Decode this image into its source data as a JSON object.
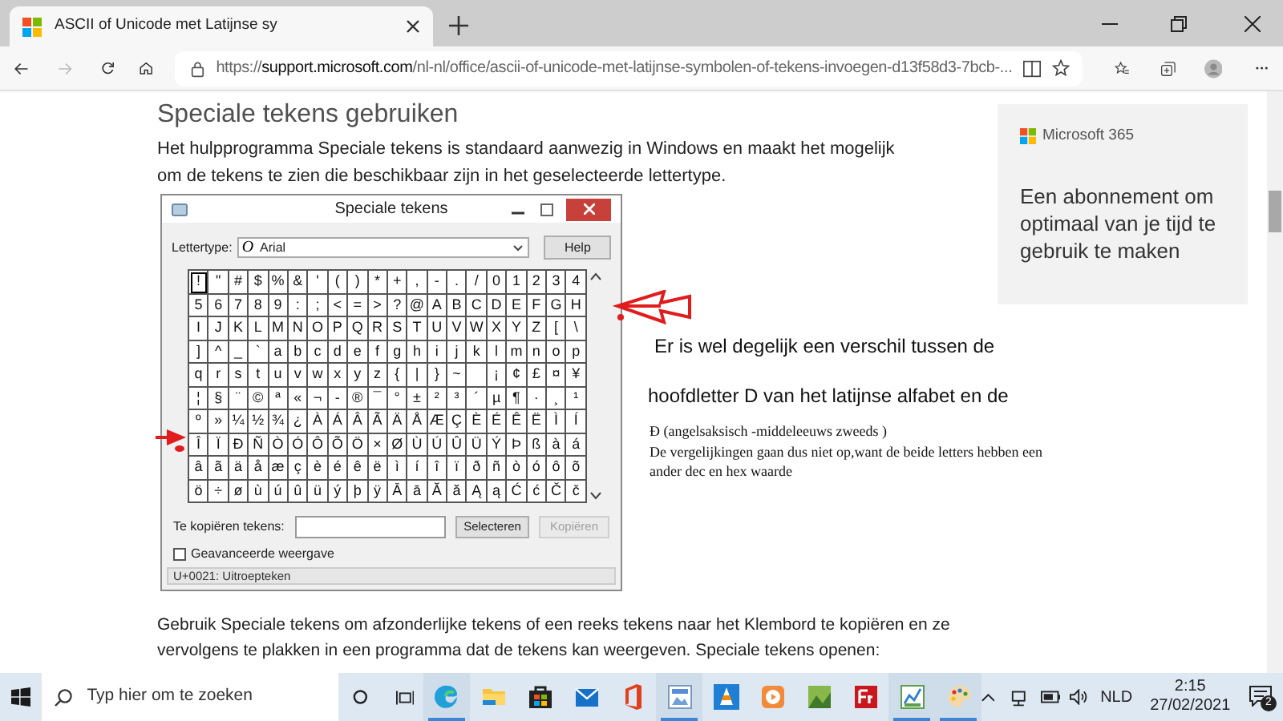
{
  "browser": {
    "tab_title": "ASCII of Unicode met Latijnse sy",
    "url_scheme": "https://",
    "url_host": "support.microsoft.com",
    "url_path": "/nl-nl/office/ascii-of-unicode-met-latijnse-symbolen-of-tekens-invoegen-d13f58d3-7bcb-..."
  },
  "article": {
    "heading": "Speciale tekens gebruiken",
    "intro": "Het hulpprogramma Speciale tekens is standaard aanwezig in Windows en maakt het mogelijk om de tekens te zien die beschikbaar zijn in het geselecteerde lettertype.",
    "char_map": {
      "title": "Speciale tekens",
      "font_label": "Lettertype:",
      "font_icon": "O",
      "font": "Arial",
      "help": "Help",
      "rows": [
        [
          "!",
          "\"",
          "#",
          "$",
          "%",
          "&",
          "'",
          "(",
          ")",
          "*",
          "+",
          ",",
          "-",
          ".",
          "/",
          "0",
          "1",
          "2",
          "3",
          "4"
        ],
        [
          "5",
          "6",
          "7",
          "8",
          "9",
          ":",
          ";",
          "<",
          "=",
          ">",
          "?",
          "@",
          "A",
          "B",
          "C",
          "D",
          "E",
          "F",
          "G",
          "H"
        ],
        [
          "I",
          "J",
          "K",
          "L",
          "M",
          "N",
          "O",
          "P",
          "Q",
          "R",
          "S",
          "T",
          "U",
          "V",
          "W",
          "X",
          "Y",
          "Z",
          "[",
          "\\"
        ],
        [
          "]",
          "^",
          "_",
          "`",
          "a",
          "b",
          "c",
          "d",
          "e",
          "f",
          "g",
          "h",
          "i",
          "j",
          "k",
          "l",
          "m",
          "n",
          "o",
          "p"
        ],
        [
          "q",
          "r",
          "s",
          "t",
          "u",
          "v",
          "w",
          "x",
          "y",
          "z",
          "{",
          "|",
          "}",
          "~",
          null,
          "¡",
          "¢",
          "£",
          "¤",
          "¥"
        ],
        [
          "¦",
          "§",
          "¨",
          "©",
          "ª",
          "«",
          "¬",
          "-",
          "®",
          "¯",
          "°",
          "±",
          "²",
          "³",
          "´",
          "µ",
          "¶",
          "·",
          "¸",
          "¹"
        ],
        [
          "º",
          "»",
          "¼",
          "½",
          "¾",
          "¿",
          "À",
          "Á",
          "Â",
          "Ã",
          "Ä",
          "Å",
          "Æ",
          "Ç",
          "È",
          "É",
          "Ê",
          "Ë",
          "Ì",
          "Í"
        ],
        [
          "Î",
          "Ï",
          "Ð",
          "Ñ",
          "Ò",
          "Ó",
          "Ô",
          "Õ",
          "Ö",
          "×",
          "Ø",
          "Ù",
          "Ú",
          "Û",
          "Ü",
          "Ý",
          "Þ",
          "ß",
          "à",
          "á"
        ],
        [
          "â",
          "ã",
          "ä",
          "å",
          "æ",
          "ç",
          "è",
          "é",
          "ê",
          "ë",
          "ì",
          "í",
          "î",
          "ï",
          "ð",
          "ñ",
          "ò",
          "ó",
          "ô",
          "õ"
        ],
        [
          "ö",
          "÷",
          "ø",
          "ù",
          "ú",
          "û",
          "ü",
          "ý",
          "þ",
          "ÿ",
          "Ā",
          "ā",
          "Ă",
          "ă",
          "Ą",
          "ą",
          "Ć",
          "ć",
          "Č",
          "č"
        ]
      ],
      "copy_label": "Te kopiëren tekens:",
      "select_button": "Selecteren",
      "copy_button": {
        "label": "Kopiëren",
        "disabled": true
      },
      "advanced": {
        "label": "Geavanceerde weergave",
        "checked": false
      },
      "status": "U+0021: Uitroepteken"
    },
    "after_text": "Gebruik Speciale tekens om afzonderlijke tekens of een reeks tekens naar het Klembord te kopiëren en ze vervolgens te plakken in een programma dat de tekens kan weergeven. Speciale tekens openen:"
  },
  "annotations": [
    {
      "kind": "sans",
      "text": "Er is wel degelijk een verschil tussen de"
    },
    {
      "kind": "sans",
      "text": "hoofdletter D van het latijnse alfabet en de"
    },
    {
      "kind": "serif",
      "text": "Ð (angelsaksisch -middeleeuws zweeds )"
    },
    {
      "kind": "serif",
      "text": "De vergelijkingen gaan dus niet op,want de beide letters hebben een"
    },
    {
      "kind": "serif",
      "text": "ander dec en hex waarde"
    }
  ],
  "ad": {
    "brand": "Microsoft 365",
    "text": "Een abonnement om optimaal van je tijd te gebruik te maken"
  },
  "taskbar": {
    "search_placeholder": "Typ hier om te zoeken",
    "apps": [
      {
        "kind": "edge",
        "running": true
      },
      {
        "kind": "folder",
        "running": false
      },
      {
        "kind": "store",
        "running": false
      },
      {
        "kind": "mail",
        "running": false
      },
      {
        "kind": "office",
        "running": false
      },
      {
        "kind": "viewer",
        "running": true
      },
      {
        "kind": "cone",
        "running": false
      },
      {
        "kind": "player",
        "running": false
      },
      {
        "kind": "image",
        "running": false
      },
      {
        "kind": "ftp",
        "running": false
      },
      {
        "kind": "chart",
        "running": true
      },
      {
        "kind": "paint",
        "running": true
      }
    ],
    "language": "NLD",
    "time": "2:15",
    "date": "27/02/2021",
    "notifications": "2"
  }
}
